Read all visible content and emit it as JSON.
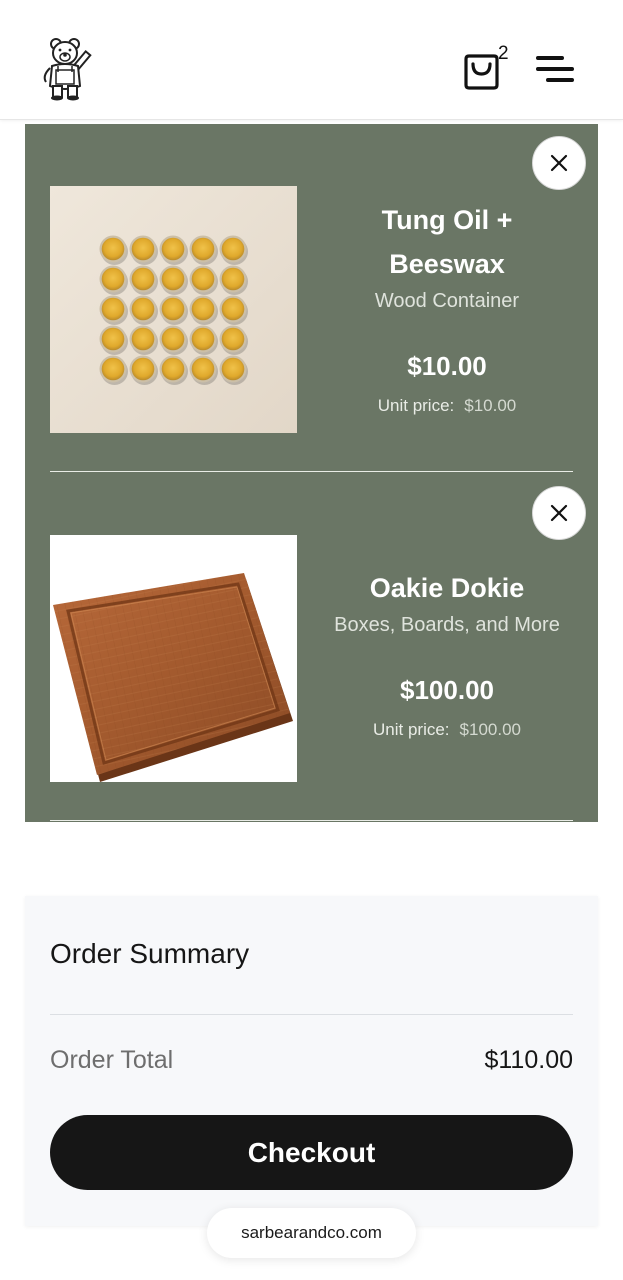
{
  "header": {
    "logo_icon": "bear-mascot-icon",
    "cart_icon": "shopping-bag-icon",
    "cart_count": "2",
    "menu_icon": "hamburger-menu-icon"
  },
  "cart": {
    "items": [
      {
        "name_line1": "Tung Oil +",
        "name_line2": "Beeswax",
        "category": "Wood Container",
        "price": "$10.00",
        "unit_label": "Unit price:",
        "unit_value": "$10.00",
        "image": "beeswax-tins-image"
      },
      {
        "name_line1": "Oakie Dokie",
        "category": "Boxes, Boards, and More",
        "price": "$100.00",
        "unit_label": "Unit price:",
        "unit_value": "$100.00",
        "image": "cutting-board-image"
      }
    ],
    "remove_icon": "close-icon"
  },
  "summary": {
    "title": "Order Summary",
    "total_label": "Order Total",
    "total_value": "$110.00",
    "checkout_label": "Checkout"
  },
  "browser": {
    "url": "sarbearandco.com"
  },
  "colors": {
    "panel": "#6a7665",
    "checkout_button": "#161616",
    "summary_bg": "#f7f8fa"
  }
}
